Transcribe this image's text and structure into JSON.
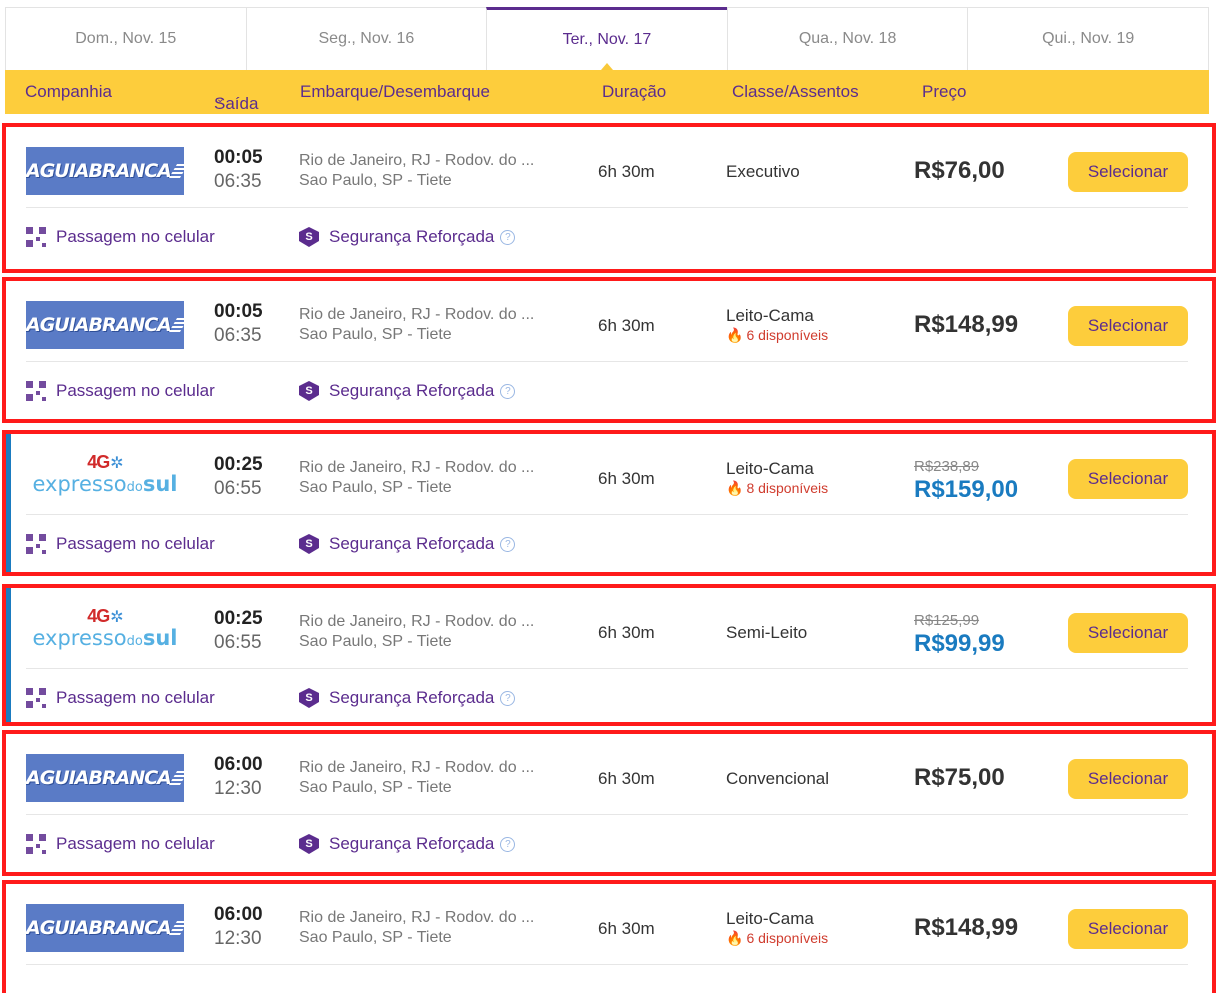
{
  "tabs": [
    {
      "label": "Dom., Nov. 15"
    },
    {
      "label": "Seg., Nov. 16"
    },
    {
      "label": "Ter., Nov. 17"
    },
    {
      "label": "Qua., Nov. 18"
    },
    {
      "label": "Qui., Nov. 19"
    }
  ],
  "active_tab": 2,
  "header": {
    "company": "Companhia",
    "departure": "Saída",
    "route": "Embarque/Desembarque",
    "duration": "Duração",
    "class": "Classe/Assentos",
    "price": "Preço"
  },
  "features": {
    "mobile_ticket": "Passagem no celular",
    "security": "Segurança Reforçada",
    "security_badge": "S",
    "help": "?"
  },
  "logos": {
    "aguia_branca": "AGUIABRANCA",
    "expresso_sul_4g": "4G",
    "expresso_sul_prefix": "expresso",
    "expresso_sul_mid": "do",
    "expresso_sul_suffix": "sul"
  },
  "trips": [
    {
      "company": "aguia_branca",
      "dep": "00:05",
      "arr": "06:35",
      "origin": "Rio de Janeiro, RJ - Rodov. do ...",
      "dest": "Sao Paulo, SP - Tiete",
      "duration": "6h 30m",
      "class": "Executivo",
      "availability": "",
      "old_price": "",
      "price": "R$76,00",
      "promo": false,
      "button": "Selecionar"
    },
    {
      "company": "aguia_branca",
      "dep": "00:05",
      "arr": "06:35",
      "origin": "Rio de Janeiro, RJ - Rodov. do ...",
      "dest": "Sao Paulo, SP - Tiete",
      "duration": "6h 30m",
      "class": "Leito-Cama",
      "availability": "6 disponíveis",
      "old_price": "",
      "price": "R$148,99",
      "promo": false,
      "button": "Selecionar"
    },
    {
      "company": "expresso_sul",
      "dep": "00:25",
      "arr": "06:55",
      "origin": "Rio de Janeiro, RJ - Rodov. do ...",
      "dest": "Sao Paulo, SP - Tiete",
      "duration": "6h 30m",
      "class": "Leito-Cama",
      "availability": "8 disponíveis",
      "old_price": "R$238,89",
      "price": "R$159,00",
      "promo": true,
      "button": "Selecionar"
    },
    {
      "company": "expresso_sul",
      "dep": "00:25",
      "arr": "06:55",
      "origin": "Rio de Janeiro, RJ - Rodov. do ...",
      "dest": "Sao Paulo, SP - Tiete",
      "duration": "6h 30m",
      "class": "Semi-Leito",
      "availability": "",
      "old_price": "R$125,99",
      "price": "R$99,99",
      "promo": true,
      "button": "Selecionar"
    },
    {
      "company": "aguia_branca",
      "dep": "06:00",
      "arr": "12:30",
      "origin": "Rio de Janeiro, RJ - Rodov. do ...",
      "dest": "Sao Paulo, SP - Tiete",
      "duration": "6h 30m",
      "class": "Convencional",
      "availability": "",
      "old_price": "",
      "price": "R$75,00",
      "promo": false,
      "button": "Selecionar"
    },
    {
      "company": "aguia_branca",
      "dep": "06:00",
      "arr": "12:30",
      "origin": "Rio de Janeiro, RJ - Rodov. do ...",
      "dest": "Sao Paulo, SP - Tiete",
      "duration": "6h 30m",
      "class": "Leito-Cama",
      "availability": "6 disponíveis",
      "old_price": "",
      "price": "R$148,99",
      "promo": false,
      "button": "Selecionar"
    }
  ],
  "colors": {
    "brand_purple": "#5b2c8e",
    "header_yellow": "#fdcd3c",
    "highlight_red": "#ff1a1a",
    "promo_blue": "#1a7bc0",
    "aguia_blue": "#5a7bc6"
  }
}
